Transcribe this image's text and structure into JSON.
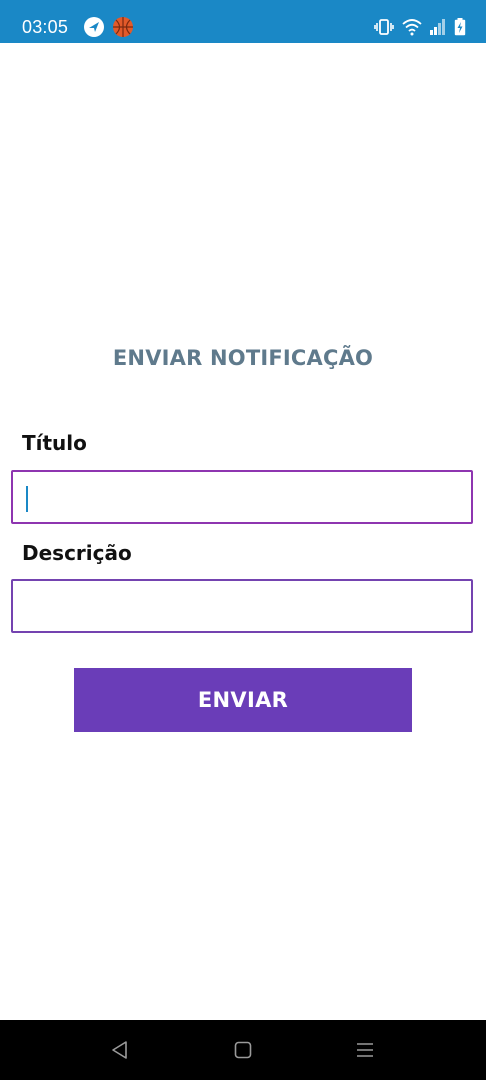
{
  "status_bar": {
    "time": "03:05",
    "background_color": "#1a88c6",
    "left_icons": [
      "navigation-arrow-icon",
      "basketball-icon"
    ],
    "right_icons": [
      "vibrate-icon",
      "wifi-icon",
      "signal-icon",
      "battery-charging-icon"
    ]
  },
  "page": {
    "title": "ENVIAR NOTIFICAÇÃO"
  },
  "form": {
    "title_label": "Título",
    "title_value": "",
    "description_label": "Descrição",
    "description_value": "",
    "submit_label": "ENVIAR",
    "accent_color": "#6a3db8",
    "field_border_color": "#8e35b0"
  },
  "nav_bar": {
    "buttons": [
      "back-icon",
      "home-icon",
      "recents-menu-icon"
    ]
  }
}
